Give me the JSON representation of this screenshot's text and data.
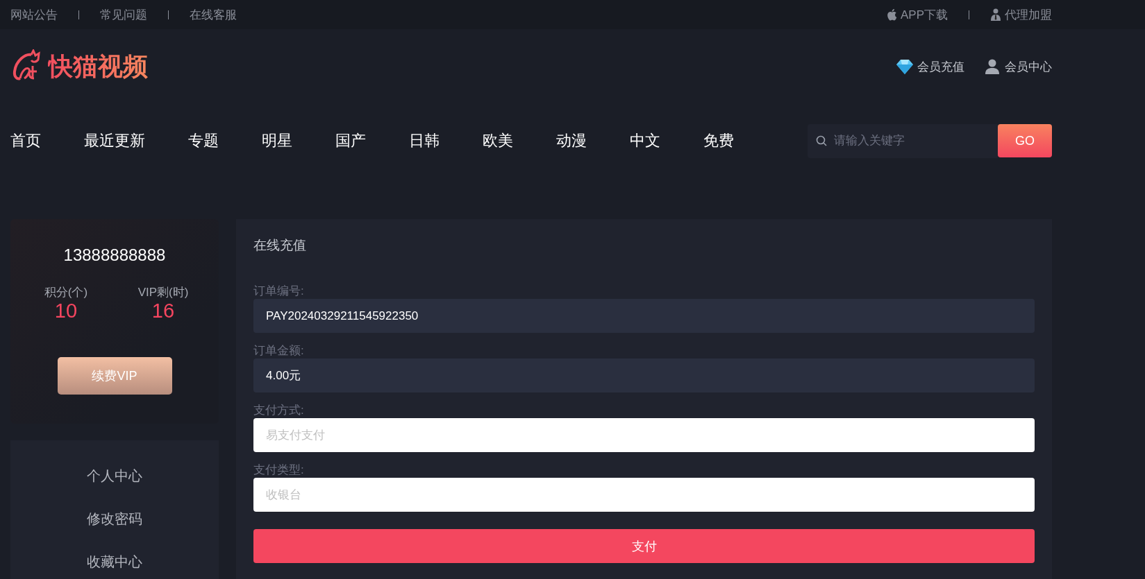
{
  "top_bar": {
    "left_links": [
      "网站公告",
      "常见问题",
      "在线客服"
    ],
    "right_links": [
      {
        "kind": "apple",
        "label": "APP下载"
      },
      {
        "kind": "agent",
        "label": "代理加盟"
      }
    ]
  },
  "header": {
    "logo_text": "快猫视频",
    "links": [
      {
        "kind": "diamond",
        "label": "会员充值"
      },
      {
        "kind": "user",
        "label": "会员中心"
      }
    ]
  },
  "nav": {
    "items": [
      "首页",
      "最近更新",
      "专题",
      "明星",
      "国产",
      "日韩",
      "欧美",
      "动漫",
      "中文",
      "免费"
    ],
    "search": {
      "placeholder": "请输入关键字",
      "button": "GO"
    }
  },
  "profile": {
    "phone": "13888888888",
    "stats": [
      {
        "label": "积分(个)",
        "value": "10"
      },
      {
        "label": "VIP剩(时)",
        "value": "16"
      }
    ],
    "button": "续费VIP"
  },
  "side_menu": [
    "个人中心",
    "修改密码",
    "收藏中心"
  ],
  "recharge": {
    "title": "在线充值",
    "fields": [
      {
        "kind": "readonly",
        "label": "订单编号:",
        "value": "PAY20240329211545922350"
      },
      {
        "kind": "readonly",
        "label": "订单金额:",
        "value": "4.00元"
      },
      {
        "kind": "select",
        "label": "支付方式:",
        "placeholder": "易支付支付"
      },
      {
        "kind": "select",
        "label": "支付类型:",
        "placeholder": "收银台"
      }
    ],
    "submit": "支付"
  }
}
